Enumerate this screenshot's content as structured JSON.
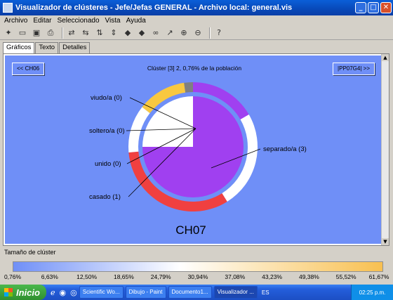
{
  "window": {
    "title": "Visualizador de clústeres - Jefe/Jefas GENERAL - Archivo local: general.vis",
    "buttons": {
      "minimize": "_",
      "maximize": "□",
      "close": "✕"
    }
  },
  "menu": {
    "items": [
      "Archivo",
      "Editar",
      "Seleccionado",
      "Vista",
      "Ayuda"
    ]
  },
  "tabs": [
    "Gráficos",
    "Texto",
    "Detalles"
  ],
  "chart": {
    "prev_button": "<< CH06",
    "next_button": "|PP07G4| >>",
    "cluster_title": "Clúster [3] 2, 0,76% de la población",
    "center_label": "CH07"
  },
  "chart_data": {
    "type": "pie",
    "title": "Clúster [3] 2, 0,76% de la población",
    "center_label": "CH07",
    "slices": [
      {
        "label": "viudo/a",
        "count": 0
      },
      {
        "label": "soltero/a",
        "count": 0
      },
      {
        "label": "unido",
        "count": 0
      },
      {
        "label": "casado",
        "count": 1
      },
      {
        "label": "separado/a",
        "count": 3
      }
    ],
    "slice_labels": [
      "viudo/a (0)",
      "soltero/a (0)",
      "unido (0)",
      "casado (1)",
      "separado/a (3)"
    ],
    "colors": {
      "casado": "#f04040",
      "separado": "#a040f0",
      "white": "#ffffff",
      "yellow": "#f8c840",
      "gray": "#808080",
      "background": "#6f8ff7"
    }
  },
  "legend": {
    "title": "Tamaño de clúster",
    "ticks": [
      "0,76%",
      "6,63%",
      "12,50%",
      "18,65%",
      "24,79%",
      "30,94%",
      "37,08%",
      "43,23%",
      "49,38%",
      "55,52%",
      "61,67%"
    ]
  },
  "taskbar": {
    "start": "Inicio",
    "tasks": [
      "Scientific Wo...",
      "Dibujo - Paint",
      "Documento1...",
      "Visualizador ..."
    ],
    "lang": "ES",
    "clock": "02:25 p.m."
  }
}
